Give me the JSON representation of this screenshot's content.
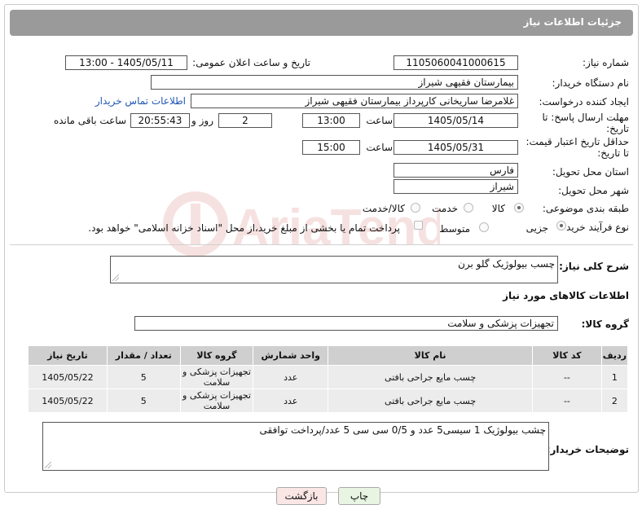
{
  "header": {
    "title": "جزئیات اطلاعات نیاز"
  },
  "form": {
    "need_number": {
      "label": "شماره نیاز:",
      "value": "1105060041000615"
    },
    "announce": {
      "label": "تاریخ و ساعت اعلان عمومی:",
      "value": "1405/05/11 - 13:00"
    },
    "buyer_org": {
      "label": "نام دستگاه خریدار:",
      "value": "بیمارستان فقیهی شیراز"
    },
    "requester": {
      "label": "ایجاد کننده درخواست:",
      "value": "غلامرضا ساریخانی کارپرداز بیمارستان فقیهی شیراز",
      "contact_link": "اطلاعات تماس خریدار"
    },
    "deadline": {
      "label_line1": "مهلت ارسال پاسخ: تا",
      "label_line2": "تاریخ:",
      "date": "1405/05/14",
      "time_label": "ساعت",
      "time": "13:00",
      "days": "2",
      "days_label": "روز و",
      "remaining": "20:55:43",
      "remaining_label": "ساعت باقی مانده"
    },
    "price_validity": {
      "label_line1": "حداقل تاریخ اعتبار قیمت:",
      "label_line2": "تا تاریخ:",
      "date": "1405/05/31",
      "time_label": "ساعت",
      "time": "15:00"
    },
    "province": {
      "label": "استان محل تحویل:",
      "value": "فارس"
    },
    "city": {
      "label": "شهر محل تحویل:",
      "value": "شیراز"
    },
    "category": {
      "label": "طبقه بندی موضوعی:",
      "options": [
        "کالا",
        "خدمت",
        "کالا/خدمت"
      ],
      "selected": "کالا"
    },
    "purchase_type": {
      "label": "نوع فرآیند خرید :",
      "options": [
        "جزیی",
        "متوسط"
      ],
      "selected": "جزیی",
      "payment_note": "پرداخت تمام یا بخشی از مبلغ خرید،از محل \"اسناد خزانه اسلامی\" خواهد بود."
    }
  },
  "summary": {
    "label": "شرح کلی نیاز:",
    "value": "چسب بیولوژیک گلو برن"
  },
  "goods_section": {
    "title": "اطلاعات کالاهای مورد نیاز"
  },
  "goods_group": {
    "label": "گروه کالا:",
    "value": "تجهیزات پزشکی و سلامت"
  },
  "table": {
    "headers": [
      "ردیف",
      "کد کالا",
      "نام کالا",
      "واحد شمارش",
      "گروه کالا",
      "تعداد / مقدار",
      "تاریخ نیاز"
    ],
    "rows": [
      [
        "1",
        "--",
        "چسب مایع جراحی بافتی",
        "عدد",
        "تجهیزات پزشکی و سلامت",
        "5",
        "1405/05/22"
      ],
      [
        "2",
        "--",
        "چسب مایع جراحی بافتی",
        "عدد",
        "تجهیزات پزشکی و سلامت",
        "5",
        "1405/05/22"
      ]
    ]
  },
  "buyer_notes": {
    "label": "توضیحات خریدار:",
    "value": "چشب بیولوژیک 1 سیسی5 عدد و 0/5 سی سی 5 عدد/پرداخت توافقی"
  },
  "buttons": {
    "print": "چاپ",
    "back": "بازگشت"
  },
  "colors": {
    "title_bar": "#9a9a9a",
    "print_button": "#e7f5e2",
    "back_button": "#fbe6e6",
    "link": "#1f56b4"
  }
}
